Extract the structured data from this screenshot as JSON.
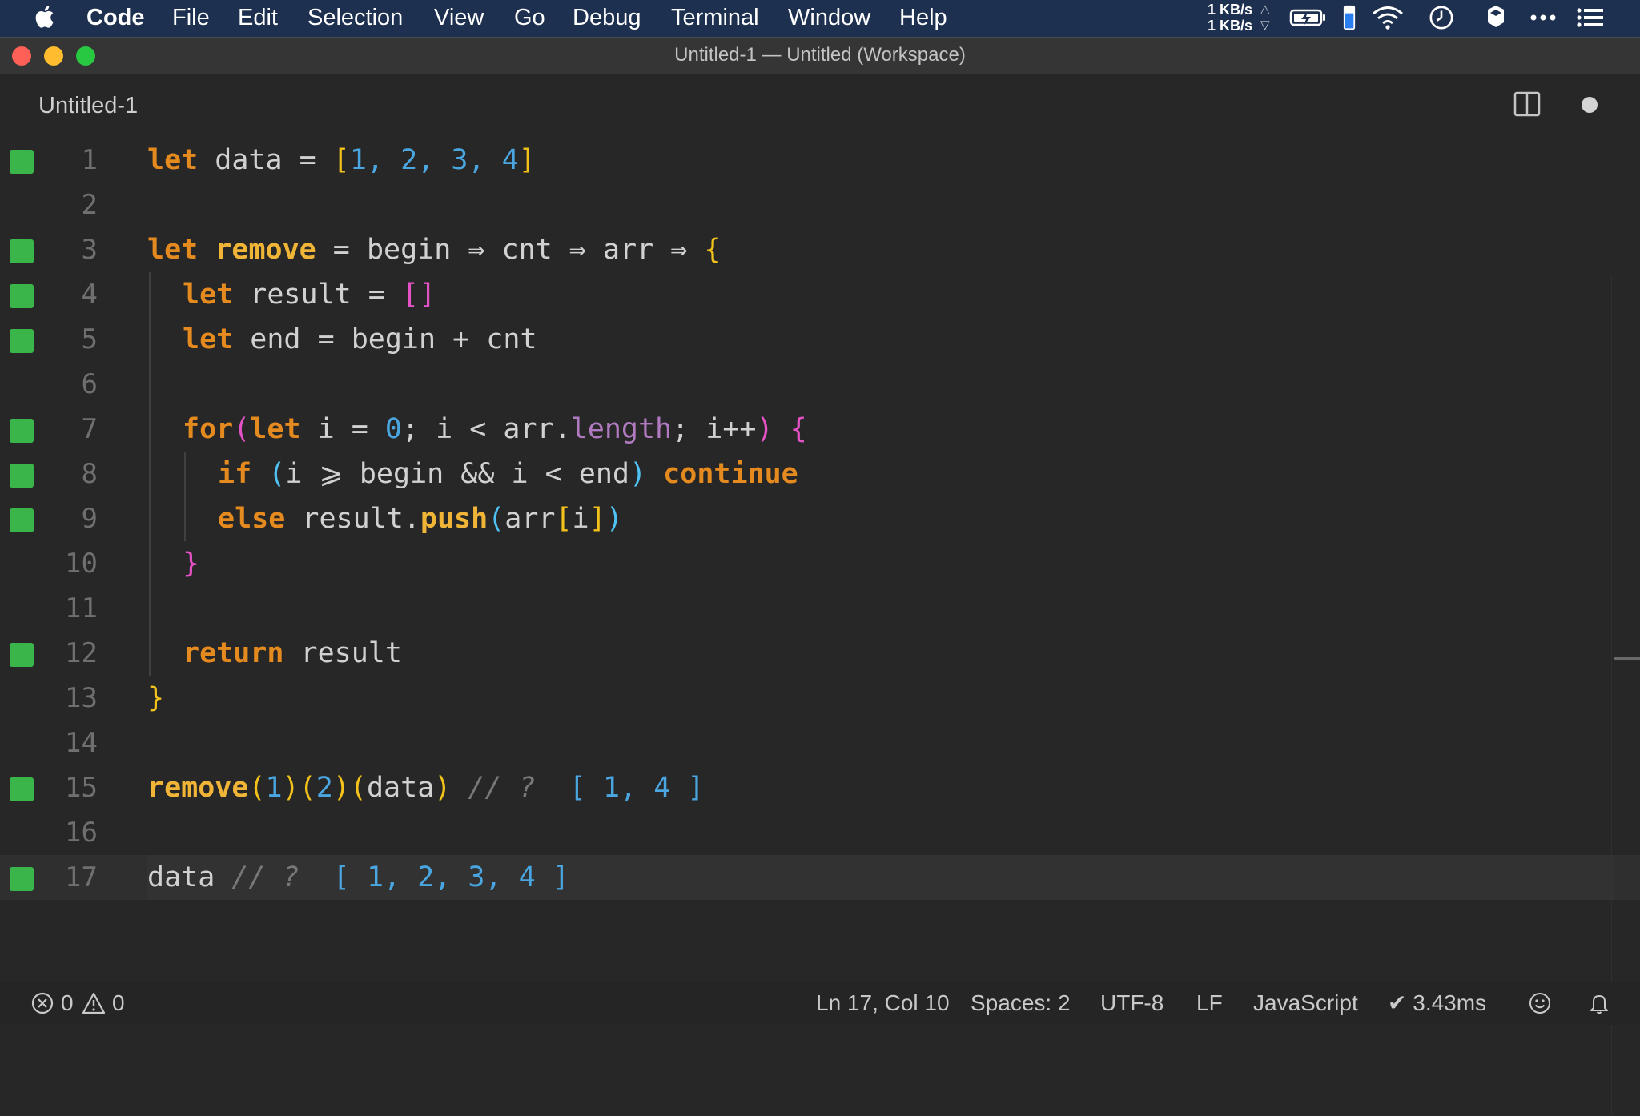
{
  "menubar": {
    "app_name": "Code",
    "items": [
      "File",
      "Edit",
      "Selection",
      "View",
      "Go",
      "Debug",
      "Terminal",
      "Window",
      "Help"
    ],
    "net_up": "1 KB/s",
    "net_down": "1 KB/s",
    "icons": [
      "apple-icon",
      "battery-icon",
      "wifi-icon",
      "clock-icon",
      "dropbox-icon",
      "more-icon",
      "list-icon"
    ]
  },
  "window": {
    "title": "Untitled-1 — Untitled (Workspace)"
  },
  "tab": {
    "label": "Untitled-1",
    "dirty": true
  },
  "editor": {
    "current_line": 17,
    "lines": [
      {
        "n": "1",
        "marker": true
      },
      {
        "n": "2",
        "marker": false
      },
      {
        "n": "3",
        "marker": true
      },
      {
        "n": "4",
        "marker": true
      },
      {
        "n": "5",
        "marker": true
      },
      {
        "n": "6",
        "marker": false
      },
      {
        "n": "7",
        "marker": true
      },
      {
        "n": "8",
        "marker": true
      },
      {
        "n": "9",
        "marker": true
      },
      {
        "n": "10",
        "marker": false
      },
      {
        "n": "11",
        "marker": false
      },
      {
        "n": "12",
        "marker": true
      },
      {
        "n": "13",
        "marker": false
      },
      {
        "n": "14",
        "marker": false
      },
      {
        "n": "15",
        "marker": true
      },
      {
        "n": "16",
        "marker": false
      },
      {
        "n": "17",
        "marker": true
      }
    ],
    "tokens": {
      "l1": [
        "let",
        " data = ",
        "[",
        "1",
        ", ",
        "2",
        ", ",
        "3",
        ", ",
        "4",
        "]"
      ],
      "l3": [
        "let",
        " ",
        "remove",
        " = begin ⇒ cnt ⇒ arr ⇒ ",
        "{"
      ],
      "l4": [
        "let",
        " result = ",
        "[]"
      ],
      "l5": [
        "let",
        " end = begin + cnt"
      ],
      "l7": [
        "for",
        "(",
        "let",
        " i = ",
        "0",
        "; i < arr.",
        "length",
        "; i++",
        ")",
        " ",
        "{"
      ],
      "l8": [
        "if",
        " ",
        "(",
        "i ⩾ begin && i < end",
        ")",
        " ",
        "continue"
      ],
      "l9": [
        "else",
        " result.",
        "push",
        "(",
        "arr",
        "[",
        "i",
        "]",
        ")"
      ],
      "l10": [
        "}"
      ],
      "l12": [
        "return",
        " result"
      ],
      "l13": [
        "}"
      ],
      "l15": [
        "remove",
        "(",
        "1",
        ")",
        "(",
        "2",
        ")",
        "(",
        "data",
        ")",
        " // ? ",
        " [ 1, 4 ]"
      ],
      "l17": [
        "data",
        " // ? ",
        " [ 1, 2, 3, 4 ]"
      ]
    }
  },
  "statusbar": {
    "errors": "0",
    "warnings": "0",
    "position": "Ln 17, Col 10",
    "spaces": "Spaces: 2",
    "encoding": "UTF-8",
    "eol": "LF",
    "language": "JavaScript",
    "timing": "✔ 3.43ms"
  }
}
